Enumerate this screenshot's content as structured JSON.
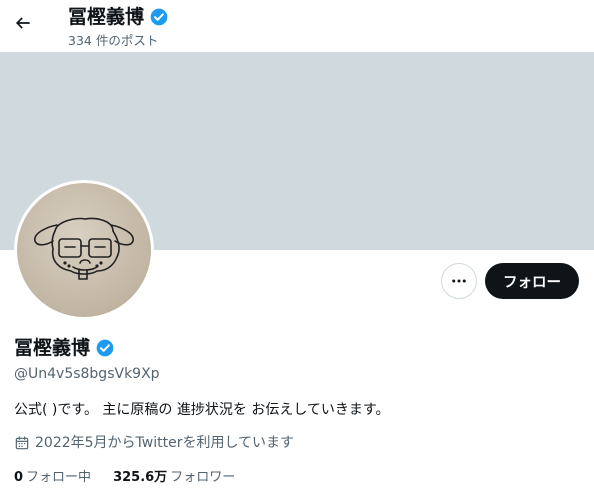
{
  "header": {
    "name": "冨樫義博",
    "posts": "334 件のポスト"
  },
  "profile": {
    "name": "冨樫義博",
    "handle": "@Un4v5s8bgsVk9Xp",
    "bio": "公式( )です。 主に原稿の 進捗状況を お伝えしていきます。",
    "joined": "2022年5月からTwitterを利用しています",
    "following_count": "0",
    "following_label": "フォロー中",
    "followers_count": "325.6万",
    "followers_label": "フォロワー"
  },
  "actions": {
    "follow_label": "フォロー"
  },
  "icons": {
    "back": "back-arrow-icon",
    "verified": "verified-badge-icon",
    "more": "more-dots-icon",
    "calendar": "calendar-icon"
  },
  "colors": {
    "banner": "#cfd9de",
    "verified": "#1d9bf0",
    "follow_button": "#0f1419",
    "secondary_text": "#536471"
  }
}
